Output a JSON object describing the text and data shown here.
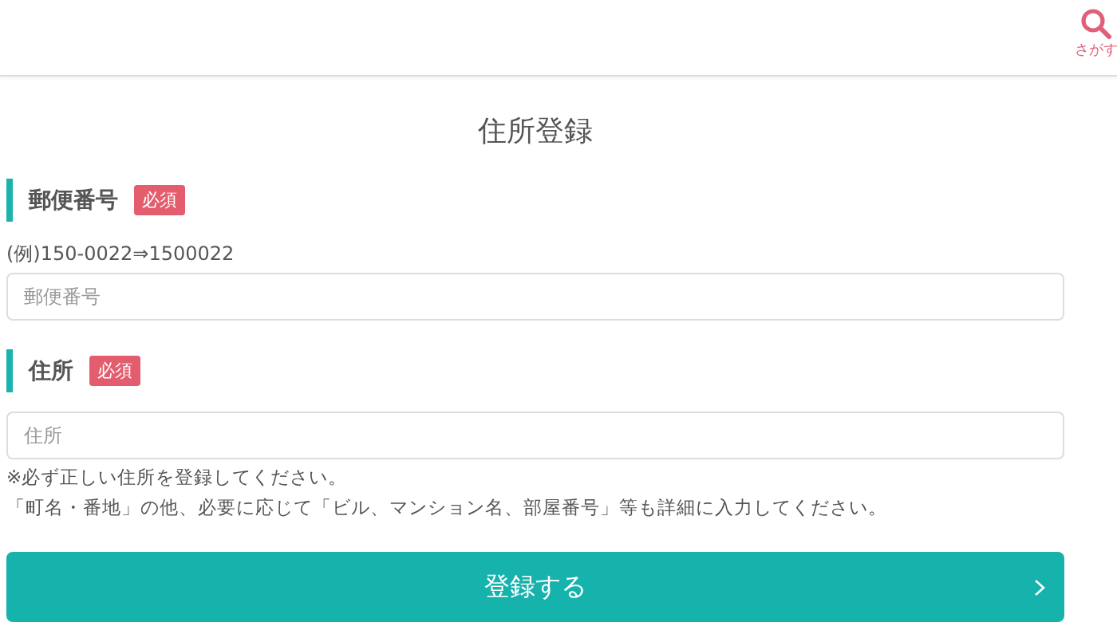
{
  "header": {
    "search_label": "さがす"
  },
  "title": "住所登録",
  "fields": [
    {
      "label": "郵便番号",
      "badge": "必須",
      "hint": "(例)150-0022⇒1500022",
      "placeholder": "郵便番号"
    },
    {
      "label": "住所",
      "badge": "必須",
      "placeholder": "住所",
      "notes": [
        "※必ず正しい住所を登録してください。",
        "「町名・番地」の他、必要に応じて「ビル、マンション名、部屋番号」等も詳細に入力してください。"
      ]
    }
  ],
  "submit": "登録する"
}
